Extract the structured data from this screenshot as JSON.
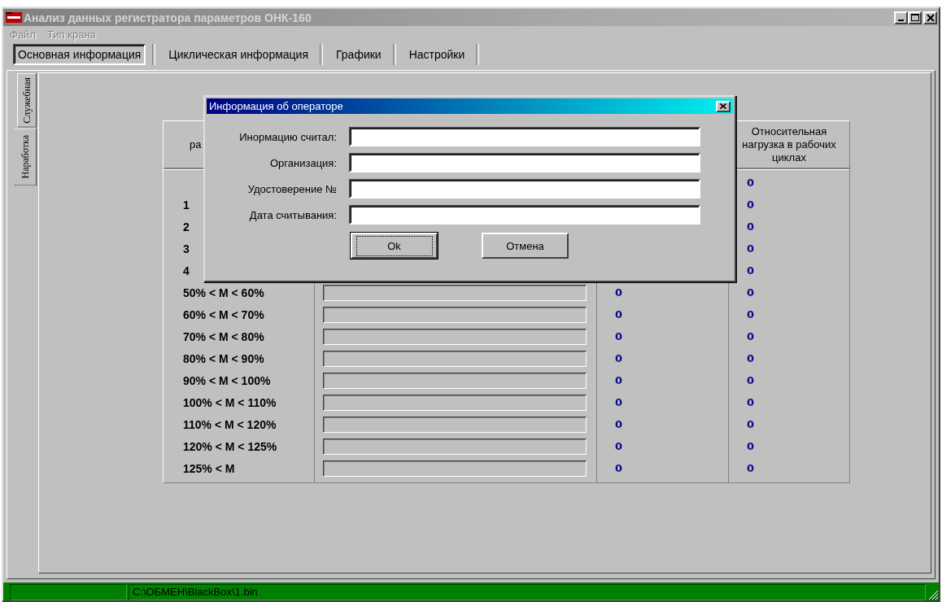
{
  "window": {
    "title": "Анализ данных регистратора параметров ОНК-160",
    "active": false
  },
  "menu": [
    {
      "label": "Файл",
      "disabled": true
    },
    {
      "label": "Тип крана",
      "disabled": true
    }
  ],
  "tabs": [
    {
      "label": "Основная информация",
      "selected": true
    },
    {
      "label": "Циклическая информация",
      "selected": false
    },
    {
      "label": "Графики",
      "selected": false
    },
    {
      "label": "Настройки",
      "selected": false
    }
  ],
  "side_tabs": [
    {
      "label": "Служебная",
      "selected": false
    },
    {
      "label": "Наработка",
      "selected": true
    }
  ],
  "table": {
    "header": {
      "column_1": "ра",
      "column_4": "Относительная нагрузка в рабочих циклах"
    },
    "rows": [
      {
        "relative": "0"
      },
      {
        "label": "1",
        "relative": "0"
      },
      {
        "label": "2",
        "relative": "0"
      },
      {
        "label": "3",
        "relative": "0"
      },
      {
        "label": "4",
        "relative": "0"
      },
      {
        "label": "50% < M < 60%",
        "count": "0",
        "relative": "0"
      },
      {
        "label": "60% < M < 70%",
        "count": "0",
        "relative": "0"
      },
      {
        "label": "70% < M < 80%",
        "count": "0",
        "relative": "0"
      },
      {
        "label": "80% < M < 90%",
        "count": "0",
        "relative": "0"
      },
      {
        "label": "90% < M < 100%",
        "count": "0",
        "relative": "0"
      },
      {
        "label": "100% < M < 110%",
        "count": "0",
        "relative": "0"
      },
      {
        "label": "110% < M < 120%",
        "count": "0",
        "relative": "0"
      },
      {
        "label": "120% < M < 125%",
        "count": "0",
        "relative": "0"
      },
      {
        "label": "125% < M",
        "count": "0",
        "relative": "0"
      }
    ]
  },
  "dialog": {
    "title": "Информация об операторе",
    "active": true,
    "fields": [
      {
        "label": "Инормацию считал:"
      },
      {
        "label": "Организация:"
      },
      {
        "label": "Удостоверение №"
      },
      {
        "label": "Дата считывания:"
      }
    ],
    "buttons": [
      {
        "label": "Ok",
        "default": true
      },
      {
        "label": "Отмена",
        "default": false
      }
    ]
  },
  "status_bar": {
    "panel_2": "C:\\ОБМЕН\\BlackBox\\1.bin"
  }
}
